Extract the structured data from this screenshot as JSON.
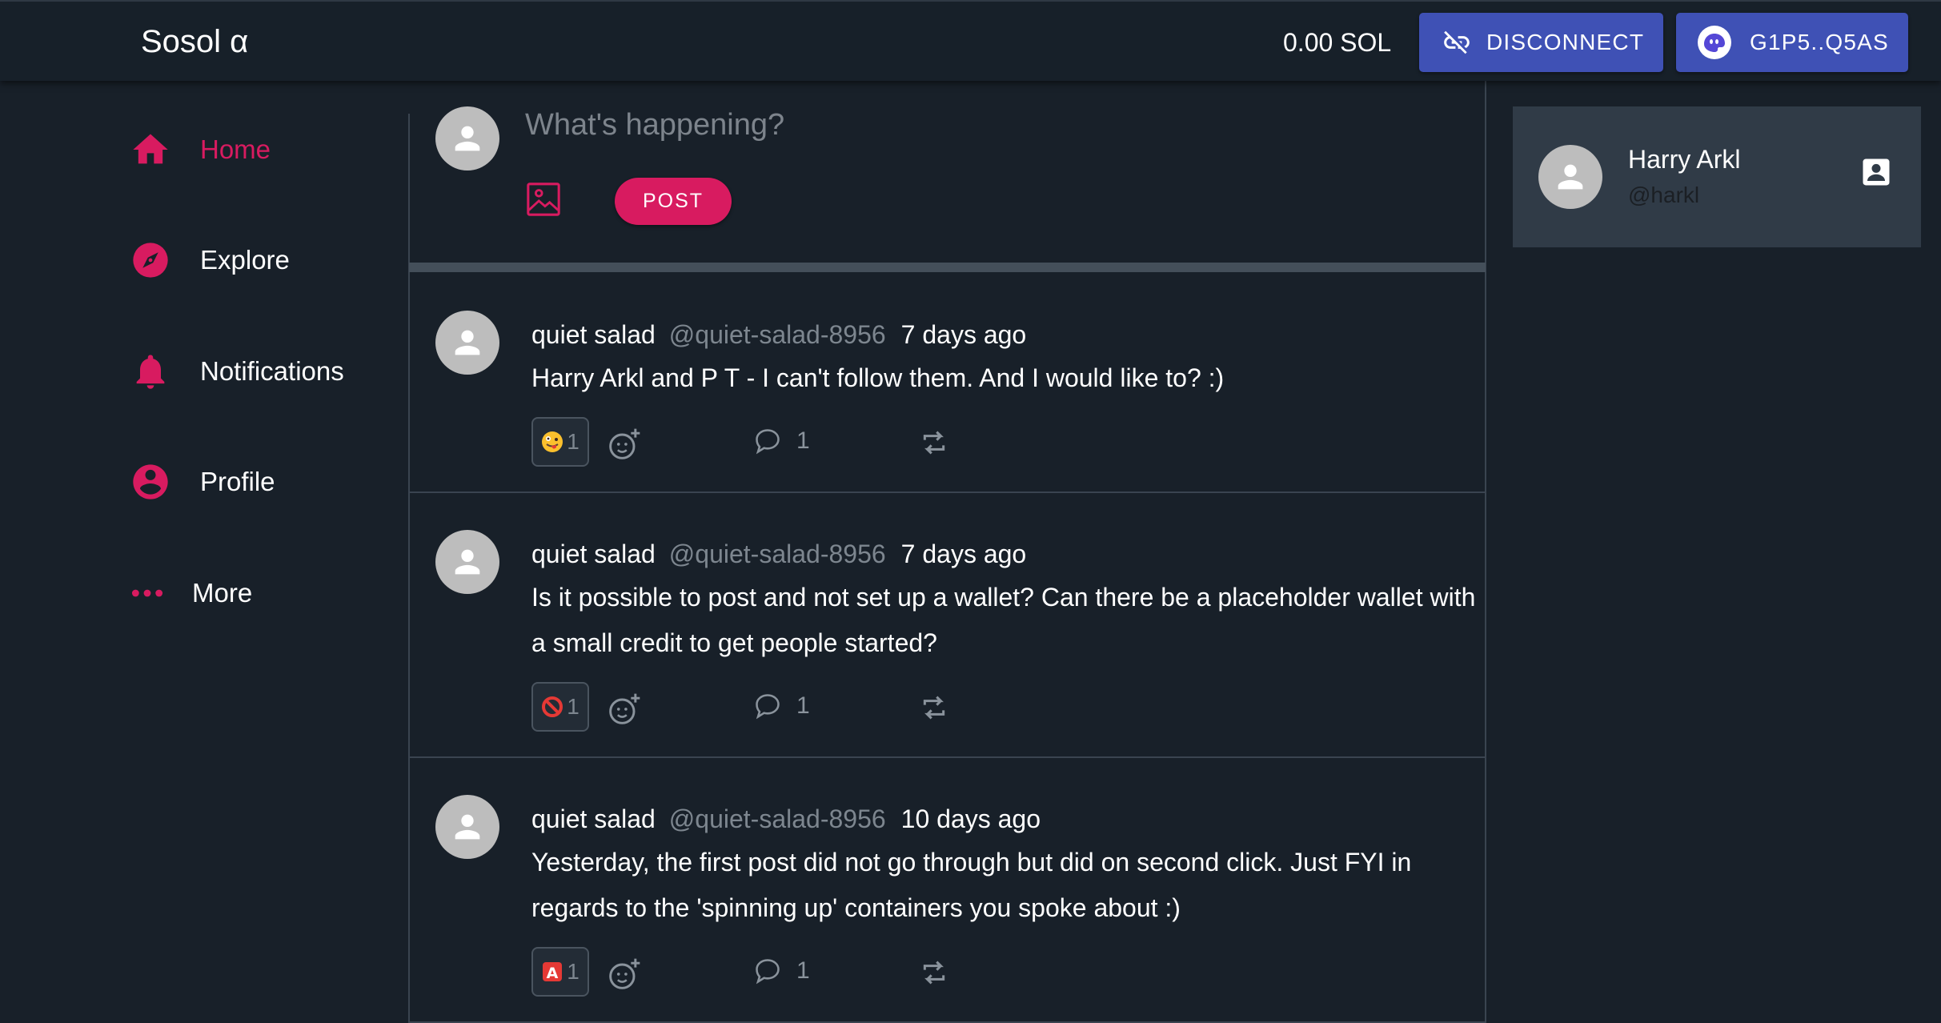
{
  "app": {
    "title": "Sosol α",
    "balance": "0.00 SOL",
    "disconnect_label": "DISCONNECT",
    "wallet_address": "G1P5..Q5AS"
  },
  "nav": {
    "items": [
      {
        "label": "Home",
        "icon": "home-icon",
        "active": true
      },
      {
        "label": "Explore",
        "icon": "compass-icon"
      },
      {
        "label": "Notifications",
        "icon": "bell-icon"
      },
      {
        "label": "Profile",
        "icon": "account-circle-icon"
      },
      {
        "label": "More",
        "icon": "more-dots-icon"
      }
    ]
  },
  "compose": {
    "placeholder": "What's happening?",
    "value": "",
    "image_icon": "image-icon",
    "post_label": "POST"
  },
  "posts": [
    {
      "author": "quiet salad",
      "handle": "@quiet-salad-8956",
      "time": "7 days ago",
      "text": "Harry Arkl and P T - I can't follow them. And I would like to? :)",
      "reaction": {
        "emoji": "zany-face",
        "count": "1"
      },
      "comments": "1"
    },
    {
      "author": "quiet salad",
      "handle": "@quiet-salad-8956",
      "time": "7 days ago",
      "text": "Is it possible to post and not set up a wallet? Can there be a placeholder wallet with a small credit to get people started?",
      "reaction": {
        "emoji": "no-entry-sign",
        "count": "1"
      },
      "comments": "1"
    },
    {
      "author": "quiet salad",
      "handle": "@quiet-salad-8956",
      "time": "10 days ago",
      "text": "Yesterday, the first post did not go through but did on second click. Just FYI in regards to the 'spinning up' containers you spoke about :)",
      "reaction": {
        "emoji": "a-button",
        "count": "1"
      },
      "comments": "1"
    }
  ],
  "profile_card": {
    "name": "Harry Arkl",
    "handle": "@harkl",
    "icon": "contact-card-icon"
  },
  "colors": {
    "background": "#182029",
    "accent": "#d81b60",
    "button": "#3f51b5",
    "card": "#303b47",
    "muted": "#7d868f"
  }
}
